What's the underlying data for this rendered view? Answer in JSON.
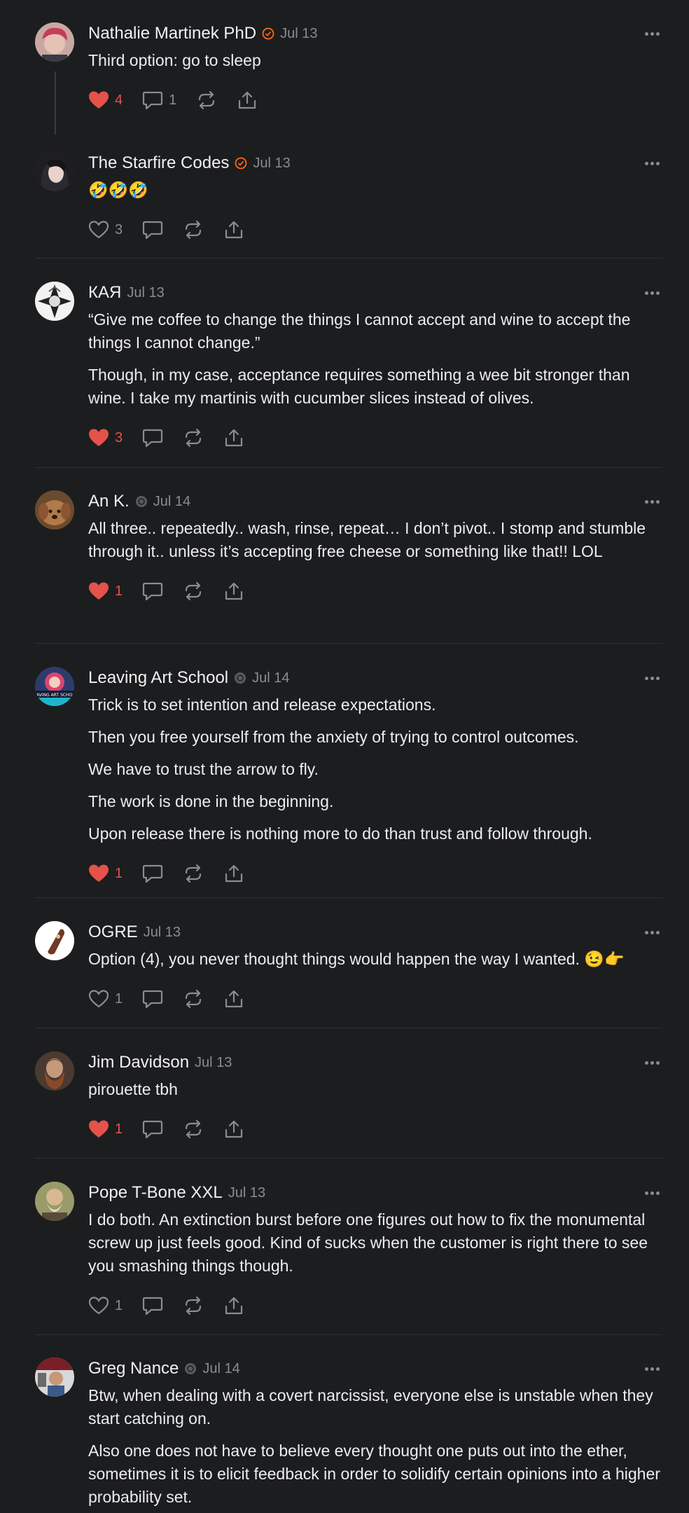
{
  "colors": {
    "background": "#1c1d1f",
    "like": "#e4524a",
    "muted": "#8b8c90",
    "verified": "#ff6719"
  },
  "comments": [
    {
      "author": "Nathalie Martinek PhD",
      "badge": "verified-check-icon",
      "date": "Jul 13",
      "paragraphs": [
        "Third option: go to sleep"
      ],
      "likes": "4",
      "liked": true,
      "replies": "1"
    },
    {
      "author": "The Starfire Codes",
      "badge": "verified-check-icon",
      "date": "Jul 13",
      "paragraphs": [
        "🤣🤣🤣"
      ],
      "likes": "3",
      "liked": false,
      "replies": ""
    },
    {
      "author": "КАЯ",
      "badge": "",
      "date": "Jul 13",
      "paragraphs": [
        "“Give me coffee to change the things I cannot accept and wine to accept the things I cannot change.”",
        "Though, in my case, acceptance requires something a wee bit stronger than wine. I take my martinis with cucumber slices instead of olives."
      ],
      "likes": "3",
      "liked": true,
      "replies": ""
    },
    {
      "author": "An K.",
      "badge": "subscriber-badge-icon",
      "date": "Jul 14",
      "paragraphs": [
        "All three.. repeatedly.. wash, rinse, repeat… I don’t pivot.. I stomp and stumble through it.. unless it’s accepting free cheese or something like that!! LOL"
      ],
      "likes": "1",
      "liked": true,
      "replies": ""
    },
    {
      "author": "Leaving Art School",
      "badge": "subscriber-badge-icon",
      "date": "Jul 14",
      "paragraphs": [
        "Trick is to set intention and release expectations.",
        "Then you free yourself from the anxiety of trying to control outcomes.",
        "We have to trust the arrow to fly.",
        "The work is done in the beginning.",
        "Upon release there is nothing more to do than trust and follow through."
      ],
      "likes": "1",
      "liked": true,
      "replies": ""
    },
    {
      "author": "OGRE",
      "badge": "",
      "date": "Jul 13",
      "paragraphs": [
        "Option (4), you never thought things would happen the way I wanted. 😉👉"
      ],
      "likes": "1",
      "liked": false,
      "replies": ""
    },
    {
      "author": "Jim Davidson",
      "badge": "",
      "date": "Jul 13",
      "paragraphs": [
        "pirouette tbh"
      ],
      "likes": "1",
      "liked": true,
      "replies": ""
    },
    {
      "author": "Pope T-Bone XXL",
      "badge": "",
      "date": "Jul 13",
      "paragraphs": [
        "I do both. An extinction burst before one figures out how to fix the monumental screw up just feels good. Kind of sucks when the customer is right there to see you smashing things though."
      ],
      "likes": "1",
      "liked": false,
      "replies": ""
    },
    {
      "author": "Greg Nance",
      "badge": "subscriber-badge-icon",
      "date": "Jul 14",
      "paragraphs": [
        "Btw, when dealing with a covert narcissist, everyone else is unstable when they start catching on.",
        "Also one does not have to believe every thought one puts out into the ether, sometimes it is to elicit feedback in order to solidify certain opinions into a higher probability set."
      ],
      "likes": "",
      "liked": false,
      "replies": ""
    }
  ]
}
